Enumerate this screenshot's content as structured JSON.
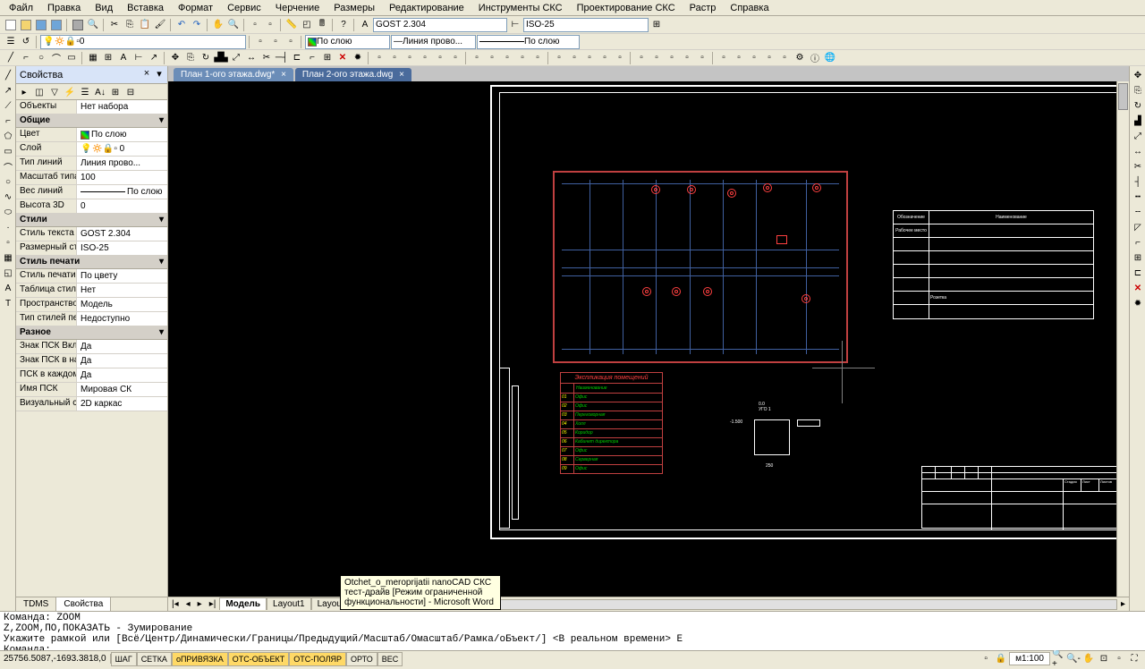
{
  "menu": [
    "Файл",
    "Правка",
    "Вид",
    "Вставка",
    "Формат",
    "Сервис",
    "Черчение",
    "Размеры",
    "Редактирование",
    "Инструменты СКС",
    "Проектирование СКС",
    "Растр",
    "Справка"
  ],
  "toolbar1": {
    "text_style": "GOST 2.304",
    "dim_style": "ISO-25"
  },
  "toolbar2": {
    "layer": "0",
    "color_label": "По слою",
    "linetype": "Линия прово...",
    "lineweight": "По слою"
  },
  "props": {
    "title": "Свойства",
    "object_label": "Объекты",
    "object_value": "Нет набора",
    "groups": [
      {
        "name": "Общие",
        "rows": [
          {
            "k": "Цвет",
            "v": "По слою",
            "swatch": true
          },
          {
            "k": "Слой",
            "v": "0",
            "layer": true
          },
          {
            "k": "Тип линий",
            "v": "Линия прово..."
          },
          {
            "k": "Масштаб типа ...",
            "v": "100"
          },
          {
            "k": "Вес линий",
            "v": "По слою",
            "line": true
          },
          {
            "k": "Высота 3D",
            "v": "0"
          }
        ]
      },
      {
        "name": "Стили",
        "rows": [
          {
            "k": "Стиль текста",
            "v": "GOST 2.304"
          },
          {
            "k": "Размерный ст...",
            "v": "ISO-25"
          }
        ]
      },
      {
        "name": "Стиль печати",
        "rows": [
          {
            "k": "Стиль печати",
            "v": "По цвету"
          },
          {
            "k": "Таблица стиле...",
            "v": "Нет"
          },
          {
            "k": "Пространство ...",
            "v": "Модель"
          },
          {
            "k": "Тип стилей печ...",
            "v": "Недоступно"
          }
        ]
      },
      {
        "name": "Разное",
        "rows": [
          {
            "k": "Знак ПСК Вкл",
            "v": "Да"
          },
          {
            "k": "Знак ПСК в на...",
            "v": "Да"
          },
          {
            "k": "ПСК в каждом ...",
            "v": "Да"
          },
          {
            "k": "Имя ПСК",
            "v": "Мировая СК"
          },
          {
            "k": "Визуальный ст...",
            "v": "2D каркас"
          }
        ]
      }
    ],
    "tabs": [
      "TDMS",
      "Свойства"
    ],
    "active_tab": 1
  },
  "doc_tabs": [
    {
      "label": "План 1-ого этажа.dwg*",
      "active": true
    },
    {
      "label": "План 2-ого этажа.dwg",
      "active": false
    }
  ],
  "layout_tabs": [
    "Модель",
    "Layout1",
    "Layout2"
  ],
  "layout_active": 0,
  "legend": {
    "headers": [
      "Обозначение",
      "Наименование"
    ],
    "rows": [
      [
        "Рабочее место",
        ""
      ],
      [
        "",
        ""
      ],
      [
        "",
        ""
      ],
      [
        "",
        ""
      ],
      [
        "",
        ""
      ],
      [
        "",
        "Розетка"
      ],
      [
        "",
        ""
      ]
    ]
  },
  "explication": {
    "title": "Экспликация помещений",
    "col": "Наименование",
    "rows": [
      [
        "01",
        "Офис"
      ],
      [
        "02",
        "Офис"
      ],
      [
        "03",
        "Переговорная"
      ],
      [
        "04",
        "Холл"
      ],
      [
        "05",
        "Коридор"
      ],
      [
        "06",
        "Кабинет директора"
      ],
      [
        "07",
        "Офис"
      ],
      [
        "08",
        "Серверная"
      ],
      [
        "09",
        "Офис"
      ]
    ]
  },
  "cmd": {
    "history": [
      "Команда: ZOOM",
      "Z,ZOOM,ПО,ПОКАЗАТЬ - Зумирование",
      "Укажите рамкой или [Всё/Центр/Динамически/Границы/Предыдущий/Масштаб/Омасштаб/Рамка/оБъект/] <В реальном времени> E"
    ],
    "prompt": "Команда:"
  },
  "status": {
    "coords": "25756.5087,-1693.3818,0",
    "toggles": [
      {
        "t": "ШАГ",
        "on": false
      },
      {
        "t": "СЕТКА",
        "on": false
      },
      {
        "t": "оПРИВЯЗКА",
        "on": true
      },
      {
        "t": "ОТС-ОБЪЕКТ",
        "on": true
      },
      {
        "t": "ОТС-ПОЛЯР",
        "on": true
      },
      {
        "t": "ОРТО",
        "on": false
      },
      {
        "t": "ВЕС",
        "on": false
      }
    ],
    "scale": "м1:100"
  },
  "tooltip": "Otchet_o_meroprijatii nanoCAD СКС тест-драйв [Режим ограниченной функциональности] - Microsoft Word"
}
